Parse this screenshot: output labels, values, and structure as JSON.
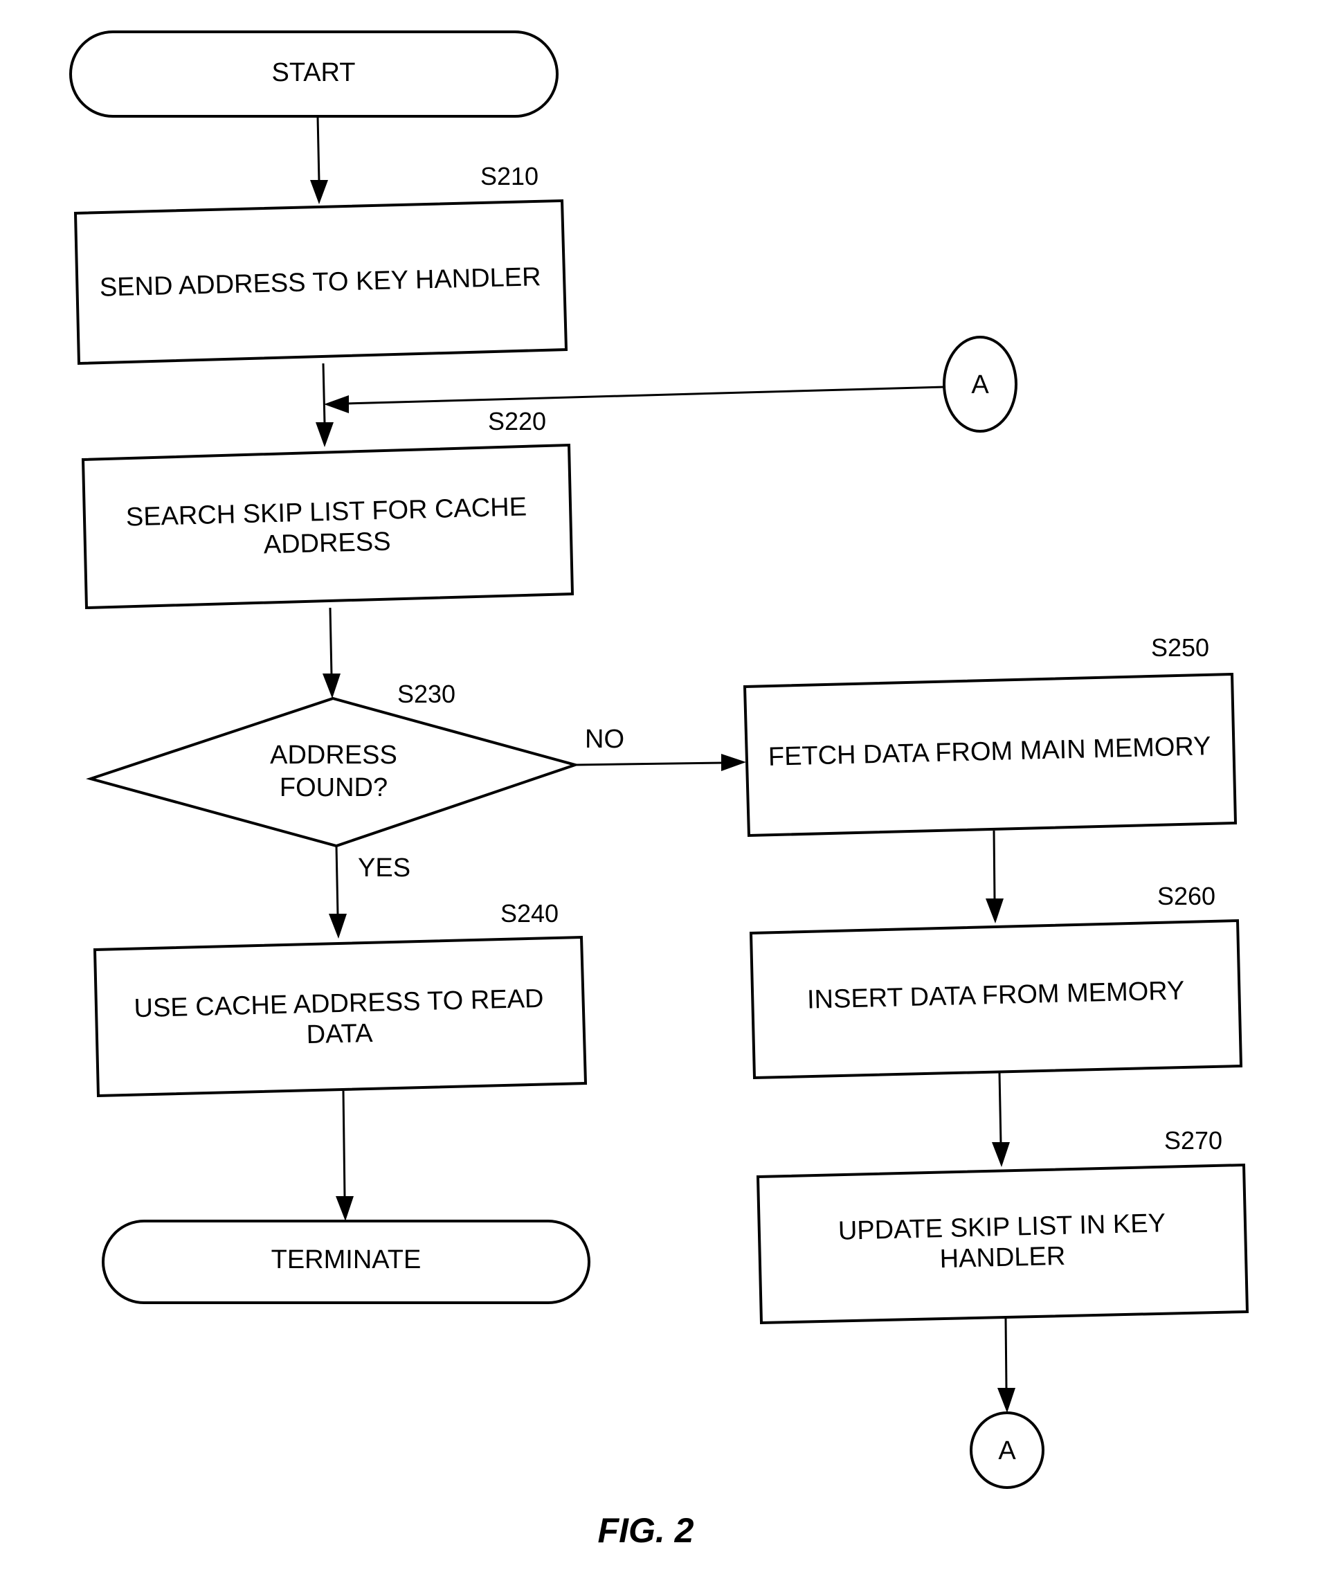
{
  "figure": {
    "caption": "FIG. 2",
    "nodes": {
      "start": {
        "label": "START"
      },
      "s210": {
        "id": "S210",
        "lines": [
          "SEND ADDRESS TO KEY HANDLER"
        ]
      },
      "s220": {
        "id": "S220",
        "lines": [
          "SEARCH SKIP LIST FOR CACHE",
          "ADDRESS"
        ]
      },
      "s230": {
        "id": "S230",
        "lines": [
          "ADDRESS",
          "FOUND?"
        ]
      },
      "s240": {
        "id": "S240",
        "lines": [
          "USE CACHE ADDRESS TO READ",
          "DATA"
        ]
      },
      "s250": {
        "id": "S250",
        "lines": [
          "FETCH DATA FROM MAIN MEMORY"
        ]
      },
      "s260": {
        "id": "S260",
        "lines": [
          "INSERT DATA FROM MEMORY"
        ]
      },
      "s270": {
        "id": "S270",
        "lines": [
          "UPDATE SKIP LIST IN KEY",
          "HANDLER"
        ]
      },
      "terminate": {
        "label": "TERMINATE"
      },
      "connector_top": {
        "label": "A"
      },
      "connector_bottom": {
        "label": "A"
      }
    },
    "edges": {
      "no_label": "NO",
      "yes_label": "YES"
    }
  }
}
